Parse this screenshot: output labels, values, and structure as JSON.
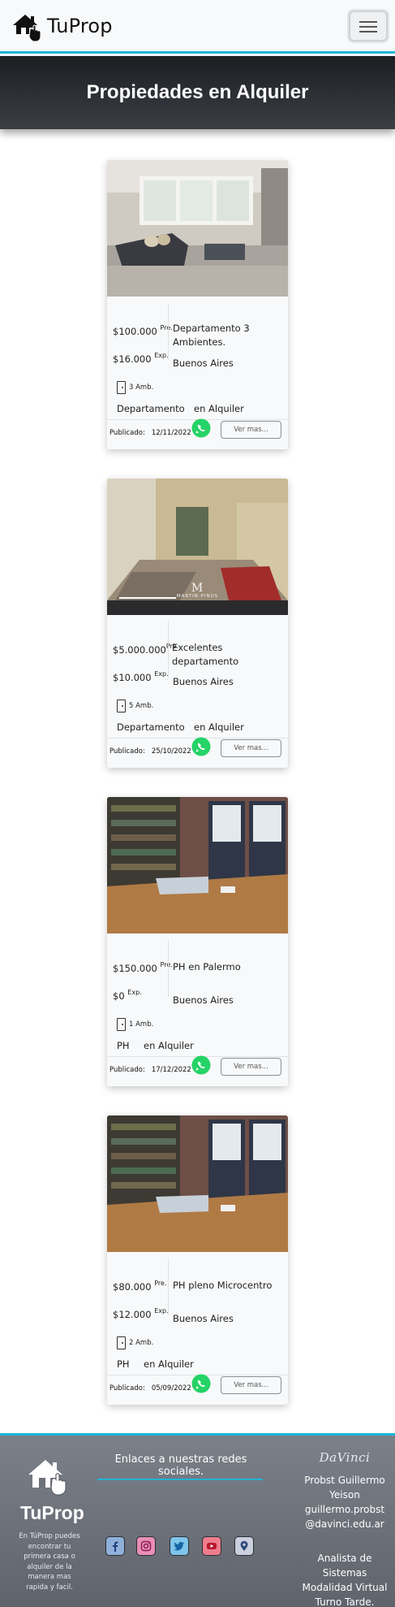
{
  "navbar": {
    "brand": "TuProp",
    "logo_icon": "house-hand-icon",
    "menu_icon": "hamburger-icon"
  },
  "hero": {
    "title": "Propiedades en Alquiler"
  },
  "cards": [
    {
      "price": "$100.000",
      "price_suffix": "Pre.",
      "expense": "$16.000",
      "expense_suffix": "Exp.",
      "title": "Departamento 3 Ambientes.",
      "city": "Buenos Aires",
      "rooms": "3 Amb.",
      "type": "Departamento",
      "operation": "en Alquiler",
      "published_label": "Publicado:",
      "published_date": "12/11/2022",
      "button": "Ver mas..."
    },
    {
      "price": "$5.000.000",
      "price_suffix": "Pre.",
      "expense": "$10.000",
      "expense_suffix": "Exp.",
      "title": "Excelentes departamento",
      "city": "Buenos Aires",
      "rooms": "5 Amb.",
      "type": "Departamento",
      "operation": "en Alquiler",
      "published_label": "Publicado:",
      "published_date": "25/10/2022",
      "button": "Ver mas...",
      "watermark": "MARTIN PINUS"
    },
    {
      "price": "$150.000",
      "price_suffix": "Pre.",
      "expense": "$0",
      "expense_suffix": "Exp.",
      "title": "PH en Palermo",
      "city": "Buenos Aires",
      "rooms": "1 Amb.",
      "type": "PH",
      "operation": "en Alquiler",
      "published_label": "Publicado:",
      "published_date": "17/12/2022",
      "button": "Ver mas..."
    },
    {
      "price": "$80.000",
      "price_suffix": "Pre.",
      "expense": "$12.000",
      "expense_suffix": "Exp.",
      "title": "PH pleno Microcentro",
      "city": "Buenos Aires",
      "rooms": "2 Amb.",
      "type": "PH",
      "operation": "en Alquiler",
      "published_label": "Publicado:",
      "published_date": "05/09/2022",
      "button": "Ver mas..."
    }
  ],
  "footer": {
    "brand": "TuProp",
    "description": "En TúProp puedes encontrar tu primera casa o alquiler de la manera mas rapida y facil.",
    "links_title": "Enlaces a nuestras redes sociales.",
    "social": [
      "facebook-icon",
      "instagram-icon",
      "twitter-icon",
      "youtube-icon",
      "location-icon"
    ],
    "school": "DaVinci",
    "author_lines": [
      "Probst Guillermo",
      "Yeison",
      "guillermo.probst",
      "@davinci.edu.ar"
    ],
    "career_lines": [
      "Analista de Sistemas",
      "Modalidad Virtual",
      "Turno Tarde."
    ]
  },
  "colors": {
    "accent": "#17b6d8",
    "hero_dark": "#1c1e22",
    "footer_gray": "#6c717a",
    "whatsapp": "#25d366"
  }
}
